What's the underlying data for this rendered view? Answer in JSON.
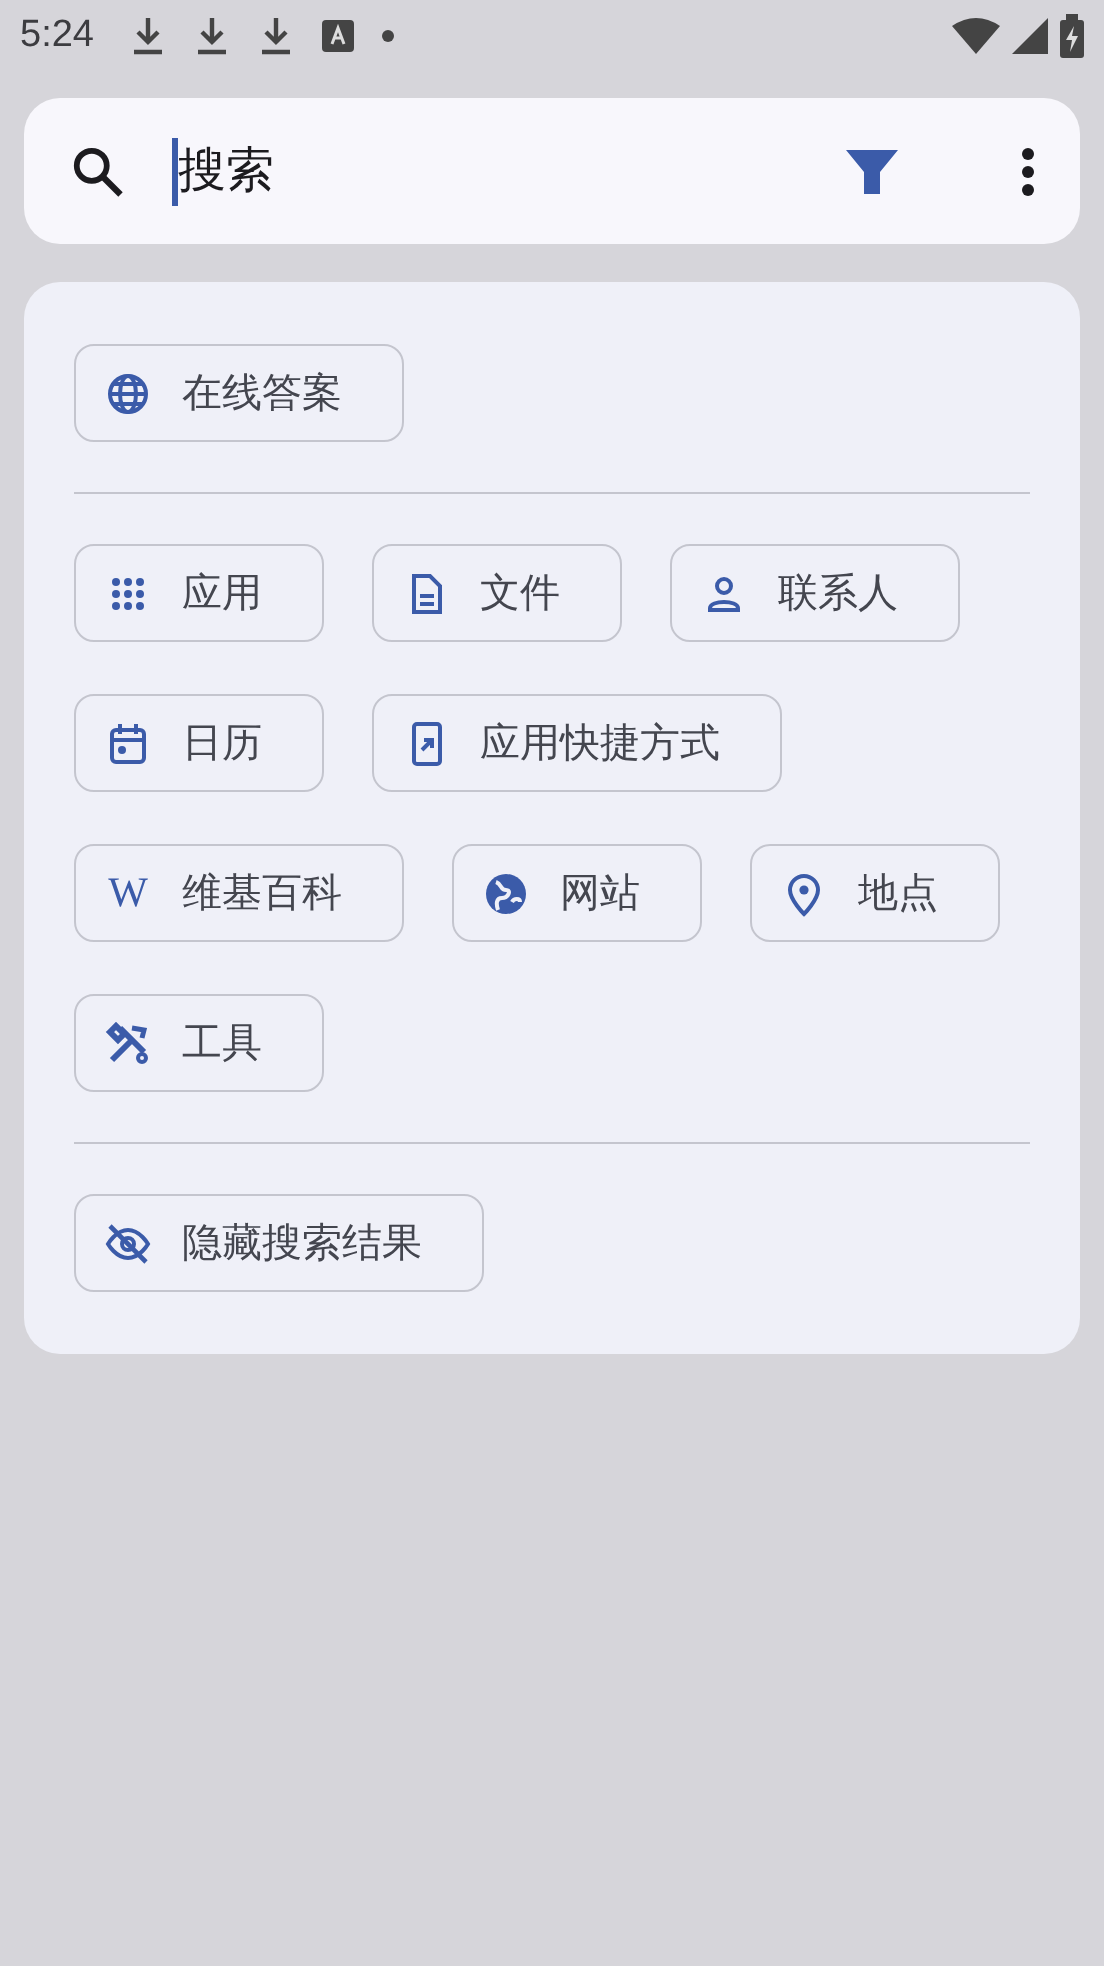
{
  "status_bar": {
    "time": "5:24"
  },
  "search": {
    "placeholder": "搜索",
    "focused": true
  },
  "sections": [
    {
      "chips": [
        {
          "kind": "globe",
          "label": "在线答案"
        }
      ]
    },
    {
      "chips": [
        {
          "kind": "apps",
          "label": "应用"
        },
        {
          "kind": "file",
          "label": "文件"
        },
        {
          "kind": "person",
          "label": "联系人"
        },
        {
          "kind": "calendar",
          "label": "日历"
        },
        {
          "kind": "shortcut",
          "label": "应用快捷方式"
        },
        {
          "kind": "letter",
          "glyph": "W",
          "label": "维基百科"
        },
        {
          "kind": "earth",
          "label": "网站"
        },
        {
          "kind": "pin",
          "label": "地点"
        },
        {
          "kind": "tools",
          "label": "工具"
        }
      ]
    },
    {
      "chips": [
        {
          "kind": "hidden",
          "label": "隐藏搜索结果"
        }
      ]
    }
  ]
}
